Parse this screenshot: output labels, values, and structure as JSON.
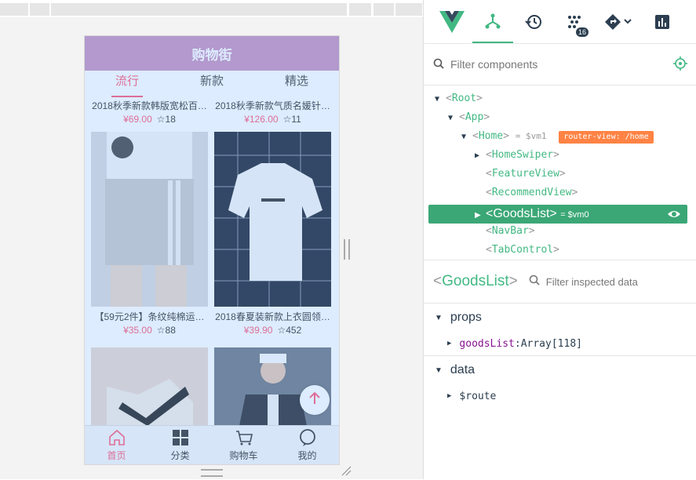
{
  "app": {
    "navbar_title": "购物街",
    "tabs": [
      "流行",
      "新款",
      "精选"
    ],
    "active_tab": 0,
    "goods": [
      {
        "title": "2018秋季新款韩版宽松百…",
        "price": "¥69.00",
        "fav": "18"
      },
      {
        "title": "2018秋季新款气质名媛针…",
        "price": "¥126.00",
        "fav": "11"
      },
      {
        "title": "【59元2件】条纹纯棉运…",
        "price": "¥35.00",
        "fav": "88"
      },
      {
        "title": "2018春夏装新款上衣圆领…",
        "price": "¥39.90",
        "fav": "452"
      },
      {
        "title": "",
        "price": "",
        "fav": ""
      },
      {
        "title": "",
        "price": "",
        "fav": ""
      }
    ],
    "mainbar": [
      {
        "label": "首页",
        "icon": "home-icon"
      },
      {
        "label": "分类",
        "icon": "category-icon"
      },
      {
        "label": "购物车",
        "icon": "cart-icon"
      },
      {
        "label": "我的",
        "icon": "profile-icon"
      }
    ],
    "backtop_icon": "arrow-up-icon",
    "colors": {
      "brand": "#ff5777",
      "navbar": "#c790be"
    }
  },
  "devtools": {
    "toolbar_badge": "16",
    "filter_placeholder": "Filter components",
    "tree": [
      {
        "name": "Root",
        "depth": 0,
        "arrow": "▼"
      },
      {
        "name": "App",
        "depth": 1,
        "arrow": "▼"
      },
      {
        "name": "Home",
        "depth": 2,
        "arrow": "▼",
        "eq": "= $vm1",
        "badge": "router-view: /home"
      },
      {
        "name": "HomeSwiper",
        "depth": 3,
        "arrow": "▶"
      },
      {
        "name": "FeatureView",
        "depth": 3,
        "arrow": ""
      },
      {
        "name": "RecommendView",
        "depth": 3,
        "arrow": ""
      },
      {
        "name": "GoodsList",
        "depth": 3,
        "arrow": "▶",
        "eq": "= $vm0",
        "selected": true
      },
      {
        "name": "NavBar",
        "depth": 3,
        "arrow": ""
      },
      {
        "name": "TabControl",
        "depth": 3,
        "arrow": ""
      }
    ],
    "inspected_component": "GoodsList",
    "inspect_placeholder": "Filter inspected data",
    "sections": [
      {
        "title": "props",
        "items": [
          {
            "key": "goodsList",
            "value": "Array[118]"
          }
        ]
      },
      {
        "title": "data",
        "items": [
          {
            "key": "$route",
            "value": ""
          }
        ]
      }
    ],
    "colors": {
      "vue_green": "#42b883",
      "selected_row": "#3ba776",
      "router_badge": "#ff8344"
    }
  }
}
